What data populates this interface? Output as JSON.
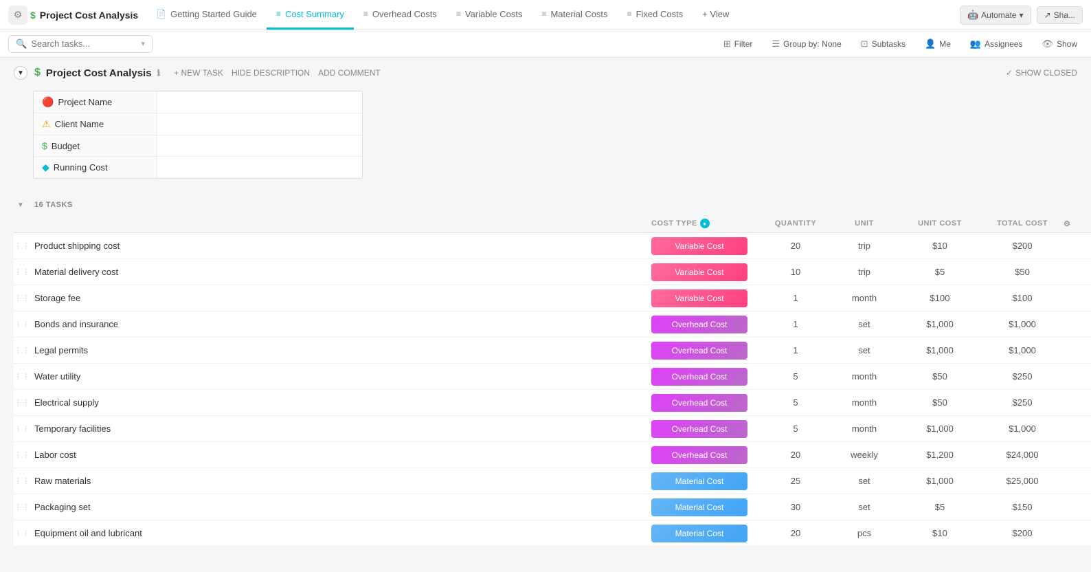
{
  "app": {
    "icon": "⚙",
    "project_title": "Project Cost Analysis",
    "dollar_icon": "$"
  },
  "tabs": [
    {
      "id": "getting-started",
      "label": "Getting Started Guide",
      "icon": "📄",
      "active": false
    },
    {
      "id": "cost-summary",
      "label": "Cost Summary",
      "icon": "≡",
      "active": true
    },
    {
      "id": "overhead-costs",
      "label": "Overhead Costs",
      "icon": "≡",
      "active": false
    },
    {
      "id": "variable-costs",
      "label": "Variable Costs",
      "icon": "≡",
      "active": false
    },
    {
      "id": "material-costs",
      "label": "Material Costs",
      "icon": "≡",
      "active": false
    },
    {
      "id": "fixed-costs",
      "label": "Fixed Costs",
      "icon": "≡",
      "active": false
    },
    {
      "id": "view",
      "label": "+ View",
      "icon": "",
      "active": false
    }
  ],
  "nav_right": {
    "automate": "Automate",
    "share": "Sha..."
  },
  "toolbar": {
    "search_placeholder": "Search tasks...",
    "filter": "Filter",
    "group_by": "Group by: None",
    "subtasks": "Subtasks",
    "me": "Me",
    "assignees": "Assignees",
    "show": "Show"
  },
  "project_header": {
    "title": "Project Cost Analysis",
    "new_task": "+ NEW TASK",
    "hide_description": "HIDE DESCRIPTION",
    "add_comment": "ADD COMMENT",
    "show_closed": "SHOW CLOSED"
  },
  "description_fields": [
    {
      "icon": "🔴",
      "label": "Project Name",
      "value": ""
    },
    {
      "icon": "⚠",
      "label": "Client Name",
      "value": ""
    },
    {
      "icon": "$",
      "label": "Budget",
      "value": ""
    },
    {
      "icon": "◆",
      "label": "Running Cost",
      "value": ""
    }
  ],
  "tasks_section": {
    "count_label": "16 TASKS",
    "columns": {
      "cost_type": "COST TYPE",
      "quantity": "QUANTITY",
      "unit": "UNIT",
      "unit_cost": "UNIT COST",
      "total_cost": "TOTAL COST"
    }
  },
  "tasks": [
    {
      "name": "Product shipping cost",
      "cost_type": "Variable Cost",
      "badge_class": "badge-variable",
      "quantity": "20",
      "unit": "trip",
      "unit_cost": "$10",
      "total_cost": "$200"
    },
    {
      "name": "Material delivery cost",
      "cost_type": "Variable Cost",
      "badge_class": "badge-variable",
      "quantity": "10",
      "unit": "trip",
      "unit_cost": "$5",
      "total_cost": "$50"
    },
    {
      "name": "Storage fee",
      "cost_type": "Variable Cost",
      "badge_class": "badge-variable",
      "quantity": "1",
      "unit": "month",
      "unit_cost": "$100",
      "total_cost": "$100"
    },
    {
      "name": "Bonds and insurance",
      "cost_type": "Overhead Cost",
      "badge_class": "badge-overhead",
      "quantity": "1",
      "unit": "set",
      "unit_cost": "$1,000",
      "total_cost": "$1,000"
    },
    {
      "name": "Legal permits",
      "cost_type": "Overhead Cost",
      "badge_class": "badge-overhead",
      "quantity": "1",
      "unit": "set",
      "unit_cost": "$1,000",
      "total_cost": "$1,000"
    },
    {
      "name": "Water utility",
      "cost_type": "Overhead Cost",
      "badge_class": "badge-overhead",
      "quantity": "5",
      "unit": "month",
      "unit_cost": "$50",
      "total_cost": "$250"
    },
    {
      "name": "Electrical supply",
      "cost_type": "Overhead Cost",
      "badge_class": "badge-overhead",
      "quantity": "5",
      "unit": "month",
      "unit_cost": "$50",
      "total_cost": "$250"
    },
    {
      "name": "Temporary facilities",
      "cost_type": "Overhead Cost",
      "badge_class": "badge-overhead",
      "quantity": "5",
      "unit": "month",
      "unit_cost": "$1,000",
      "total_cost": "$1,000"
    },
    {
      "name": "Labor cost",
      "cost_type": "Overhead Cost",
      "badge_class": "badge-overhead",
      "quantity": "20",
      "unit": "weekly",
      "unit_cost": "$1,200",
      "total_cost": "$24,000"
    },
    {
      "name": "Raw materials",
      "cost_type": "Material Cost",
      "badge_class": "badge-material",
      "quantity": "25",
      "unit": "set",
      "unit_cost": "$1,000",
      "total_cost": "$25,000"
    },
    {
      "name": "Packaging set",
      "cost_type": "Material Cost",
      "badge_class": "badge-material",
      "quantity": "30",
      "unit": "set",
      "unit_cost": "$5",
      "total_cost": "$150"
    },
    {
      "name": "Equipment oil and lubricant",
      "cost_type": "Material Cost",
      "badge_class": "badge-material",
      "quantity": "20",
      "unit": "pcs",
      "unit_cost": "$10",
      "total_cost": "$200"
    }
  ],
  "icons": {
    "search": "🔍",
    "filter": "⊞",
    "group": "☰",
    "subtasks": "⊡",
    "user": "👤",
    "assignees": "👥",
    "show": "👁",
    "drag": "⋮⋮",
    "collapse_open": "▼",
    "info": "ℹ",
    "chevron_down": "▾",
    "check": "✓",
    "settings": "⚙"
  }
}
